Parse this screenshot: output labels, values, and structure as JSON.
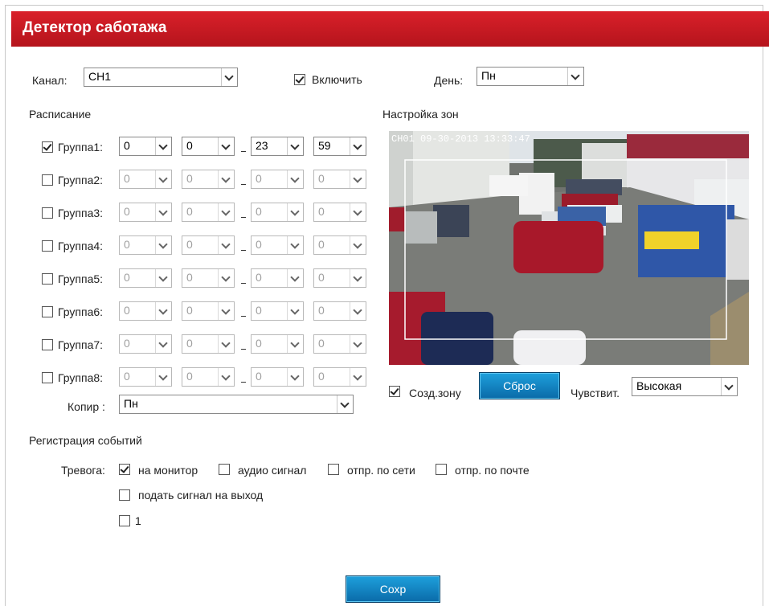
{
  "title": "Детектор саботажа",
  "channel": {
    "label": "Канал:",
    "value": "CH1"
  },
  "enable": {
    "label": "Включить",
    "checked": true
  },
  "day": {
    "label": "День:",
    "value": "Пн"
  },
  "schedule": {
    "label": "Расписание",
    "groups": [
      {
        "label": "Группа1:",
        "checked": true,
        "values": [
          "0",
          "0",
          "23",
          "59"
        ]
      },
      {
        "label": "Группа2:",
        "checked": false,
        "values": [
          "0",
          "0",
          "0",
          "0"
        ]
      },
      {
        "label": "Группа3:",
        "checked": false,
        "values": [
          "0",
          "0",
          "0",
          "0"
        ]
      },
      {
        "label": "Группа4:",
        "checked": false,
        "values": [
          "0",
          "0",
          "0",
          "0"
        ]
      },
      {
        "label": "Группа5:",
        "checked": false,
        "values": [
          "0",
          "0",
          "0",
          "0"
        ]
      },
      {
        "label": "Группа6:",
        "checked": false,
        "values": [
          "0",
          "0",
          "0",
          "0"
        ]
      },
      {
        "label": "Группа7:",
        "checked": false,
        "values": [
          "0",
          "0",
          "0",
          "0"
        ]
      },
      {
        "label": "Группа8:",
        "checked": false,
        "values": [
          "0",
          "0",
          "0",
          "0"
        ]
      }
    ],
    "copy": {
      "label": "Копир :",
      "value": "Пн"
    }
  },
  "zones": {
    "label": "Настройка зон",
    "osd": "CH01  09-30-2013 13:33:47",
    "create_zone": {
      "label": "Созд.зону",
      "checked": true
    },
    "reset_label": "Сброс",
    "sensitivity": {
      "label": "Чувствит.",
      "value": "Высокая"
    }
  },
  "events": {
    "label": "Регистрация событий",
    "alarm_label": "Тревога:",
    "options": [
      {
        "label": "на монитор",
        "checked": true
      },
      {
        "label": "аудио сигнал",
        "checked": false
      },
      {
        "label": "отпр. по сети",
        "checked": false
      },
      {
        "label": "отпр. по почте",
        "checked": false
      },
      {
        "label": "подать сигнал на выход",
        "checked": false
      },
      {
        "label": "1",
        "checked": false
      }
    ]
  },
  "save_label": "Сохр",
  "colors": {
    "header": "#c8161e",
    "button": "#1583c6"
  }
}
